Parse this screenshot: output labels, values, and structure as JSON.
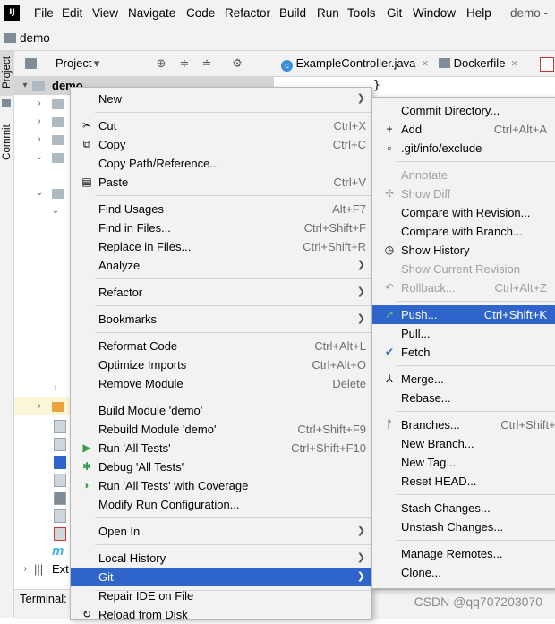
{
  "menubar": {
    "logo": "IJ",
    "items": [
      "File",
      "Edit",
      "View",
      "Navigate",
      "Code",
      "Refactor",
      "Build",
      "Run",
      "Tools",
      "Git",
      "Window",
      "Help"
    ],
    "window_project": "demo -"
  },
  "navbar": {
    "project": "demo"
  },
  "toolstrip": {
    "project_tab": "Project",
    "commit_tab": "Commit"
  },
  "project_panel": {
    "title": "Project",
    "root": "demo"
  },
  "editor": {
    "tabs": [
      {
        "label": "ExampleController.java",
        "icon": "class-icon"
      },
      {
        "label": "Dockerfile",
        "icon": "docker-icon"
      }
    ],
    "brace": "}"
  },
  "tree": {
    "ext_label": "Ext"
  },
  "bottom": {
    "terminal": "Terminal:"
  },
  "main_menu": {
    "items": [
      {
        "label": "New",
        "submenu": true
      },
      {
        "label": "Cut",
        "shortcut": "Ctrl+X",
        "icon": "scissors-icon"
      },
      {
        "label": "Copy",
        "shortcut": "Ctrl+C",
        "icon": "copy-icon"
      },
      {
        "label": "Copy Path/Reference..."
      },
      {
        "label": "Paste",
        "shortcut": "Ctrl+V",
        "icon": "paste-icon"
      },
      {
        "label": "Find Usages",
        "shortcut": "Alt+F7"
      },
      {
        "label": "Find in Files...",
        "shortcut": "Ctrl+Shift+F"
      },
      {
        "label": "Replace in Files...",
        "shortcut": "Ctrl+Shift+R"
      },
      {
        "label": "Analyze",
        "submenu": true
      },
      {
        "label": "Refactor",
        "submenu": true
      },
      {
        "label": "Bookmarks",
        "submenu": true
      },
      {
        "label": "Reformat Code",
        "shortcut": "Ctrl+Alt+L"
      },
      {
        "label": "Optimize Imports",
        "shortcut": "Ctrl+Alt+O"
      },
      {
        "label": "Remove Module",
        "shortcut": "Delete"
      },
      {
        "label": "Build Module 'demo'"
      },
      {
        "label": "Rebuild Module 'demo'",
        "shortcut": "Ctrl+Shift+F9"
      },
      {
        "label": "Run 'All Tests'",
        "shortcut": "Ctrl+Shift+F10",
        "icon": "run-icon"
      },
      {
        "label": "Debug 'All Tests'",
        "icon": "debug-icon"
      },
      {
        "label": "Run 'All Tests' with Coverage",
        "icon": "coverage-icon"
      },
      {
        "label": "Modify Run Configuration..."
      },
      {
        "label": "Open In",
        "submenu": true
      },
      {
        "label": "Local History",
        "submenu": true
      },
      {
        "label": "Git",
        "submenu": true,
        "selected": true
      },
      {
        "label": "Repair IDE on File"
      },
      {
        "label": "Reload from Disk",
        "icon": "reload-icon"
      }
    ]
  },
  "git_menu": {
    "items": [
      {
        "label": "Commit Directory..."
      },
      {
        "label": "Add",
        "shortcut": "Ctrl+Alt+A",
        "icon": "plus-icon"
      },
      {
        "label": ".git/info/exclude",
        "icon": "file-icon"
      },
      {
        "label": "Annotate",
        "disabled": true
      },
      {
        "label": "Show Diff",
        "disabled": true,
        "icon": "diff-icon"
      },
      {
        "label": "Compare with Revision..."
      },
      {
        "label": "Compare with Branch..."
      },
      {
        "label": "Show History",
        "icon": "history-icon"
      },
      {
        "label": "Show Current Revision",
        "disabled": true
      },
      {
        "label": "Rollback...",
        "shortcut": "Ctrl+Alt+Z",
        "disabled": true,
        "icon": "rollback-icon"
      },
      {
        "label": "Push...",
        "shortcut": "Ctrl+Shift+K",
        "selected": true,
        "icon": "push-arrow-icon"
      },
      {
        "label": "Pull..."
      },
      {
        "label": "Fetch",
        "icon": "fetch-check-icon"
      },
      {
        "label": "Merge...",
        "icon": "merge-icon"
      },
      {
        "label": "Rebase..."
      },
      {
        "label": "Branches...",
        "shortcut": "Ctrl+Shift+`",
        "icon": "branch-icon"
      },
      {
        "label": "New Branch..."
      },
      {
        "label": "New Tag..."
      },
      {
        "label": "Reset HEAD..."
      },
      {
        "label": "Stash Changes..."
      },
      {
        "label": "Unstash Changes..."
      },
      {
        "label": "Manage Remotes..."
      },
      {
        "label": "Clone..."
      }
    ]
  },
  "watermark": "CSDN @qq707203070",
  "colors": {
    "selection": "#2f65ca",
    "menu_bg": "#f2f2f2",
    "disabled": "#a0a0a0",
    "push_icon": "#3a9b4c"
  }
}
